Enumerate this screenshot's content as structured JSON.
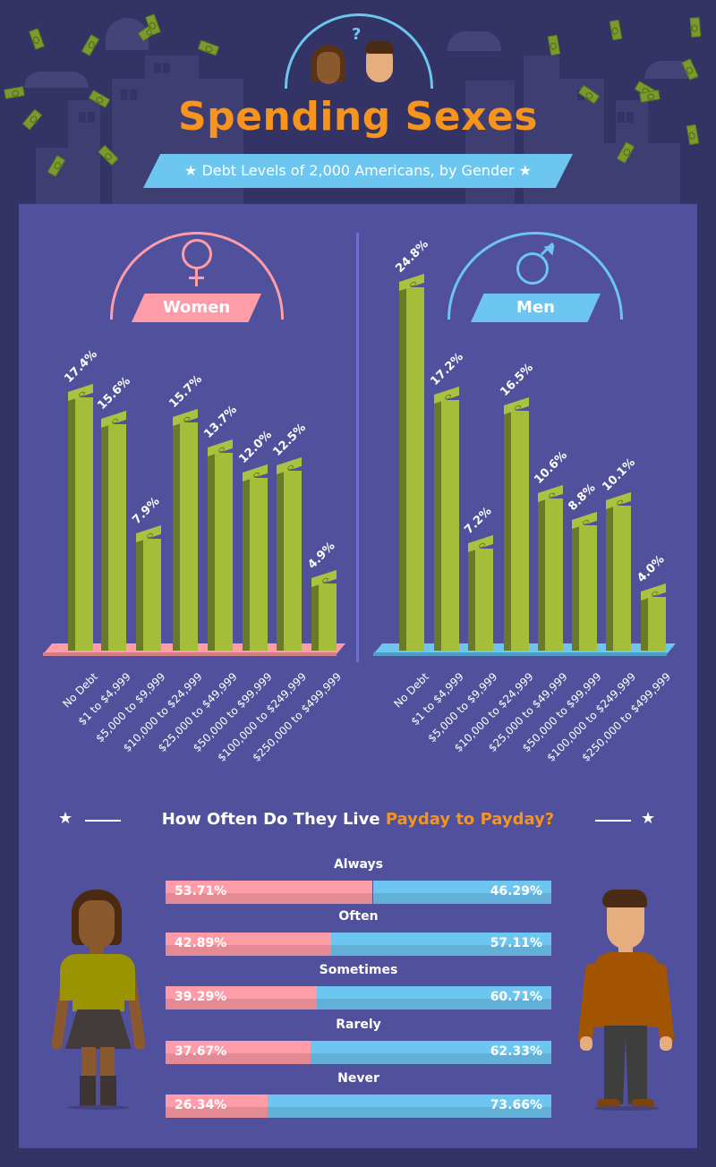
{
  "header": {
    "title": "Spending Sexes",
    "subtitle": "★ Debt Levels of 2,000 Americans, by Gender ★",
    "question_mark": "?"
  },
  "colors": {
    "title_orange": "#f7941d",
    "women_pink": "#ff9ca8",
    "men_blue": "#6cc6f0",
    "bar_green": "#a4be3a",
    "panel_bg": "#51509c",
    "page_bg": "#343366"
  },
  "women_panel": {
    "label": "Women",
    "symbol": "♀"
  },
  "men_panel": {
    "label": "Men",
    "symbol": "♂"
  },
  "chart_data": [
    {
      "type": "bar",
      "title": "Women",
      "xlabel": "",
      "ylabel": "",
      "categories": [
        "No Debt",
        "$1 to $4,999",
        "$5,000 to $9,999",
        "$10,000 to $24,999",
        "$25,000 to $49,999",
        "$50,000 to $99,999",
        "$100,000 to $249,999",
        "$250,000 to $499,999"
      ],
      "values": [
        17.4,
        15.6,
        7.9,
        15.7,
        13.7,
        12.0,
        12.5,
        4.9
      ],
      "labels": [
        "17.4%",
        "15.6%",
        "7.9%",
        "15.7%",
        "13.7%",
        "12.0%",
        "12.5%",
        "4.9%"
      ],
      "ylim": [
        0,
        25
      ],
      "grid": false
    },
    {
      "type": "bar",
      "title": "Men",
      "xlabel": "",
      "ylabel": "",
      "categories": [
        "No Debt",
        "$1 to $4,999",
        "$5,000 to $9,999",
        "$10,000 to $24,999",
        "$25,000 to $49,999",
        "$50,000 to $99,999",
        "$100,000 to $249,999",
        "$250,000 to $499,999"
      ],
      "values": [
        24.8,
        17.2,
        7.2,
        16.5,
        10.6,
        8.8,
        10.1,
        4.0
      ],
      "labels": [
        "24.8%",
        "17.2%",
        "7.2%",
        "16.5%",
        "10.6%",
        "8.8%",
        "10.1%",
        "4.0%"
      ],
      "ylim": [
        0,
        25
      ],
      "grid": false
    },
    {
      "type": "bar",
      "orientation": "horizontal-stacked",
      "title_prefix": "How Often Do They Live ",
      "title_accent": "Payday to Payday?",
      "categories": [
        "Always",
        "Often",
        "Sometimes",
        "Rarely",
        "Never"
      ],
      "series": [
        {
          "name": "Women",
          "values": [
            53.71,
            42.89,
            39.29,
            37.67,
            26.34
          ],
          "labels": [
            "53.71%",
            "42.89%",
            "39.29%",
            "37.67%",
            "26.34%"
          ]
        },
        {
          "name": "Men",
          "values": [
            46.29,
            57.11,
            60.71,
            62.33,
            73.66
          ],
          "labels": [
            "46.29%",
            "57.11%",
            "60.71%",
            "62.33%",
            "73.66%"
          ]
        }
      ],
      "xlim": [
        0,
        100
      ]
    }
  ]
}
